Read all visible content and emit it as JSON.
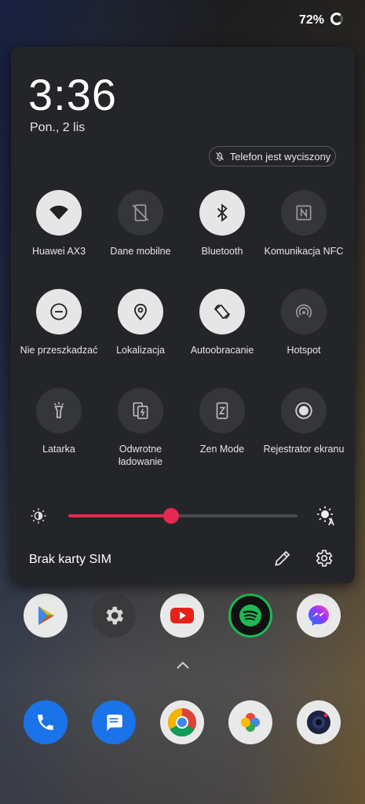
{
  "status_bar": {
    "battery": "72%"
  },
  "panel": {
    "time": "3:36",
    "date": "Pon., 2 lis",
    "silent_chip": "Telefon jest wyciszony",
    "tiles": [
      {
        "label": "Huawei AX3",
        "icon": "wifi-icon",
        "on": true
      },
      {
        "label": "Dane mobilne",
        "icon": "mobile-data-off-icon",
        "on": false
      },
      {
        "label": "Bluetooth",
        "icon": "bluetooth-icon",
        "on": true
      },
      {
        "label": "Komunikacja NFC",
        "icon": "nfc-icon",
        "on": false
      },
      {
        "label": "Nie przeszkadzać",
        "icon": "do-not-disturb-icon",
        "on": true
      },
      {
        "label": "Lokalizacja",
        "icon": "location-icon",
        "on": true
      },
      {
        "label": "Autoobracanie",
        "icon": "auto-rotate-icon",
        "on": true
      },
      {
        "label": "Hotspot",
        "icon": "hotspot-icon",
        "on": false
      },
      {
        "label": "Latarka",
        "icon": "flashlight-icon",
        "on": false
      },
      {
        "label": "Odwrotne\nładowanie",
        "icon": "reverse-charging-icon",
        "on": false
      },
      {
        "label": "Zen Mode",
        "icon": "zen-mode-icon",
        "on": false
      },
      {
        "label": "Rejestrator ekranu",
        "icon": "screen-recorder-icon",
        "on": false
      }
    ],
    "brightness": {
      "level": 0.45,
      "accent": "#e5294e"
    },
    "sim_text": "Brak karty SIM"
  },
  "dock_top": [
    "play-store-icon",
    "settings-app-icon",
    "youtube-icon",
    "spotify-icon",
    "messenger-icon"
  ],
  "dock_bottom": [
    "phone-icon",
    "messages-icon",
    "chrome-icon",
    "google-photos-icon",
    "camera-icon"
  ]
}
